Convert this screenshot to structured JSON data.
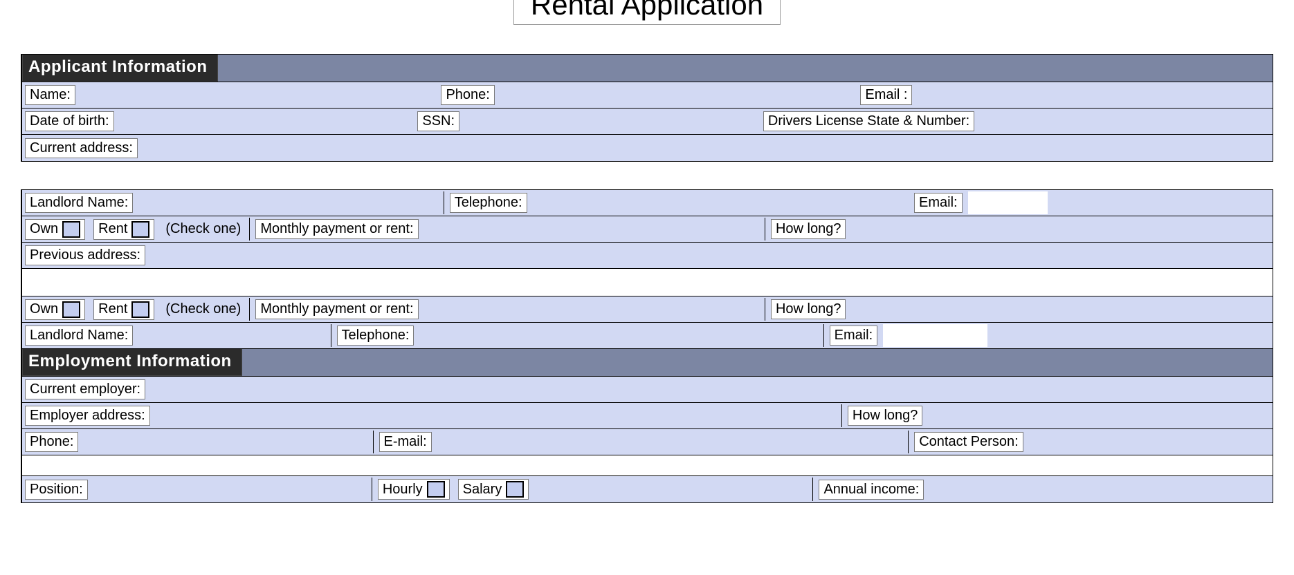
{
  "title": "Rental Application",
  "sections": {
    "applicant": {
      "header": "Applicant Information",
      "name": "Name:",
      "phone": "Phone:",
      "email": "Email :",
      "dob": "Date of birth:",
      "ssn": "SSN:",
      "dl": "Drivers License State & Number:",
      "current_address": "Current address:"
    },
    "residence_current": {
      "landlord": "Landlord Name:",
      "telephone": "Telephone:",
      "email": "Email:",
      "own": "Own",
      "rent": "Rent",
      "check_one": "(Check one)",
      "monthly": "Monthly payment or rent:",
      "how_long": "How long?",
      "previous_address": "Previous address:"
    },
    "residence_previous": {
      "own": "Own",
      "rent": "Rent",
      "check_one": "(Check one)",
      "monthly": "Monthly payment or rent:",
      "how_long": "How long?",
      "landlord": "Landlord Name:",
      "telephone": "Telephone:",
      "email": "Email:"
    },
    "employment": {
      "header": "Employment Information",
      "current_employer": "Current employer:",
      "employer_address": "Employer address:",
      "how_long": "How long?",
      "phone": "Phone:",
      "email": "E-mail:",
      "contact": "Contact Person:",
      "position": "Position:",
      "hourly": "Hourly",
      "salary": "Salary",
      "annual_income": "Annual income:"
    }
  }
}
